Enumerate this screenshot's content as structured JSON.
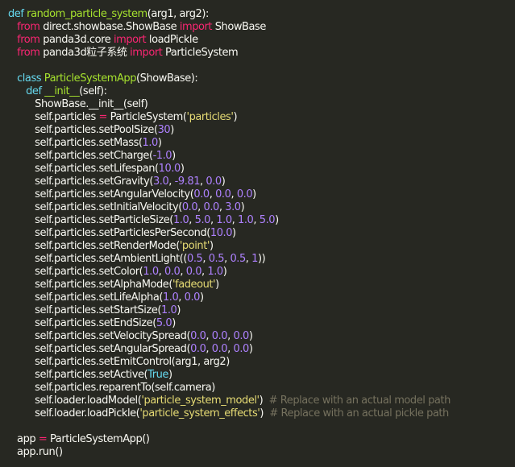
{
  "colors": {
    "background": "#272822",
    "keyword": "#f92672",
    "definition": "#66d9ef",
    "function_name": "#a6e22e",
    "number": "#ae81ff",
    "string": "#e6db74",
    "comment": "#75715e",
    "text": "#f8f8f2"
  },
  "code_lines": [
    [
      {
        "t": "def",
        "c": "def"
      },
      {
        "t": " ",
        "c": "plain"
      },
      {
        "t": "random_particle_system",
        "c": "fn"
      },
      {
        "t": "(arg1, arg2):",
        "c": "plain"
      }
    ],
    [
      {
        "t": "   ",
        "c": "plain"
      },
      {
        "t": "from",
        "c": "kw"
      },
      {
        "t": " direct.showbase.ShowBase ",
        "c": "plain"
      },
      {
        "t": "import",
        "c": "kw"
      },
      {
        "t": " ShowBase",
        "c": "plain"
      }
    ],
    [
      {
        "t": "   ",
        "c": "plain"
      },
      {
        "t": "from",
        "c": "kw"
      },
      {
        "t": " panda3d.core ",
        "c": "plain"
      },
      {
        "t": "import",
        "c": "kw"
      },
      {
        "t": " loadPickle",
        "c": "plain"
      }
    ],
    [
      {
        "t": "   ",
        "c": "plain"
      },
      {
        "t": "from",
        "c": "kw"
      },
      {
        "t": " panda3d粒子系统 ",
        "c": "plain"
      },
      {
        "t": "import",
        "c": "kw"
      },
      {
        "t": " ParticleSystem",
        "c": "plain"
      }
    ],
    [],
    [
      {
        "t": "   ",
        "c": "plain"
      },
      {
        "t": "class",
        "c": "def"
      },
      {
        "t": " ",
        "c": "plain"
      },
      {
        "t": "ParticleSystemApp",
        "c": "fn"
      },
      {
        "t": "(ShowBase):",
        "c": "plain"
      }
    ],
    [
      {
        "t": "      ",
        "c": "plain"
      },
      {
        "t": "def",
        "c": "def"
      },
      {
        "t": " ",
        "c": "plain"
      },
      {
        "t": "__init__",
        "c": "fn"
      },
      {
        "t": "(self):",
        "c": "plain"
      }
    ],
    [
      {
        "t": "         ShowBase.__init__(self)",
        "c": "plain"
      }
    ],
    [
      {
        "t": "         self.particles ",
        "c": "plain"
      },
      {
        "t": "=",
        "c": "op"
      },
      {
        "t": " ParticleSystem(",
        "c": "plain"
      },
      {
        "t": "'particles'",
        "c": "str"
      },
      {
        "t": ")",
        "c": "plain"
      }
    ],
    [
      {
        "t": "         self.particles.setPoolSize(",
        "c": "plain"
      },
      {
        "t": "30",
        "c": "num"
      },
      {
        "t": ")",
        "c": "plain"
      }
    ],
    [
      {
        "t": "         self.particles.setMass(",
        "c": "plain"
      },
      {
        "t": "1.0",
        "c": "num"
      },
      {
        "t": ")",
        "c": "plain"
      }
    ],
    [
      {
        "t": "         self.particles.setCharge(",
        "c": "plain"
      },
      {
        "t": "-1.0",
        "c": "num"
      },
      {
        "t": ")",
        "c": "plain"
      }
    ],
    [
      {
        "t": "         self.particles.setLifespan(",
        "c": "plain"
      },
      {
        "t": "10.0",
        "c": "num"
      },
      {
        "t": ")",
        "c": "plain"
      }
    ],
    [
      {
        "t": "         self.particles.setGravity(",
        "c": "plain"
      },
      {
        "t": "3.0",
        "c": "num"
      },
      {
        "t": ", ",
        "c": "plain"
      },
      {
        "t": "-9.81",
        "c": "num"
      },
      {
        "t": ", ",
        "c": "plain"
      },
      {
        "t": "0.0",
        "c": "num"
      },
      {
        "t": ")",
        "c": "plain"
      }
    ],
    [
      {
        "t": "         self.particles.setAngularVelocity(",
        "c": "plain"
      },
      {
        "t": "0.0",
        "c": "num"
      },
      {
        "t": ", ",
        "c": "plain"
      },
      {
        "t": "0.0",
        "c": "num"
      },
      {
        "t": ", ",
        "c": "plain"
      },
      {
        "t": "0.0",
        "c": "num"
      },
      {
        "t": ")",
        "c": "plain"
      }
    ],
    [
      {
        "t": "         self.particles.setInitialVelocity(",
        "c": "plain"
      },
      {
        "t": "0.0",
        "c": "num"
      },
      {
        "t": ", ",
        "c": "plain"
      },
      {
        "t": "0.0",
        "c": "num"
      },
      {
        "t": ", ",
        "c": "plain"
      },
      {
        "t": "3.0",
        "c": "num"
      },
      {
        "t": ")",
        "c": "plain"
      }
    ],
    [
      {
        "t": "         self.particles.setParticleSize(",
        "c": "plain"
      },
      {
        "t": "1.0",
        "c": "num"
      },
      {
        "t": ", ",
        "c": "plain"
      },
      {
        "t": "5.0",
        "c": "num"
      },
      {
        "t": ", ",
        "c": "plain"
      },
      {
        "t": "1.0",
        "c": "num"
      },
      {
        "t": ", ",
        "c": "plain"
      },
      {
        "t": "1.0",
        "c": "num"
      },
      {
        "t": ", ",
        "c": "plain"
      },
      {
        "t": "5.0",
        "c": "num"
      },
      {
        "t": ")",
        "c": "plain"
      }
    ],
    [
      {
        "t": "         self.particles.setParticlesPerSecond(",
        "c": "plain"
      },
      {
        "t": "10.0",
        "c": "num"
      },
      {
        "t": ")",
        "c": "plain"
      }
    ],
    [
      {
        "t": "         self.particles.setRenderMode(",
        "c": "plain"
      },
      {
        "t": "'point'",
        "c": "str"
      },
      {
        "t": ")",
        "c": "plain"
      }
    ],
    [
      {
        "t": "         self.particles.setAmbientLight((",
        "c": "plain"
      },
      {
        "t": "0.5",
        "c": "num"
      },
      {
        "t": ", ",
        "c": "plain"
      },
      {
        "t": "0.5",
        "c": "num"
      },
      {
        "t": ", ",
        "c": "plain"
      },
      {
        "t": "0.5",
        "c": "num"
      },
      {
        "t": ", ",
        "c": "plain"
      },
      {
        "t": "1",
        "c": "num"
      },
      {
        "t": "))",
        "c": "plain"
      }
    ],
    [
      {
        "t": "         self.particles.setColor(",
        "c": "plain"
      },
      {
        "t": "1.0",
        "c": "num"
      },
      {
        "t": ", ",
        "c": "plain"
      },
      {
        "t": "0.0",
        "c": "num"
      },
      {
        "t": ", ",
        "c": "plain"
      },
      {
        "t": "0.0",
        "c": "num"
      },
      {
        "t": ", ",
        "c": "plain"
      },
      {
        "t": "1.0",
        "c": "num"
      },
      {
        "t": ")",
        "c": "plain"
      }
    ],
    [
      {
        "t": "         self.particles.setAlphaMode(",
        "c": "plain"
      },
      {
        "t": "'fadeout'",
        "c": "str"
      },
      {
        "t": ")",
        "c": "plain"
      }
    ],
    [
      {
        "t": "         self.particles.setLifeAlpha(",
        "c": "plain"
      },
      {
        "t": "1.0",
        "c": "num"
      },
      {
        "t": ", ",
        "c": "plain"
      },
      {
        "t": "0.0",
        "c": "num"
      },
      {
        "t": ")",
        "c": "plain"
      }
    ],
    [
      {
        "t": "         self.particles.setStartSize(",
        "c": "plain"
      },
      {
        "t": "1.0",
        "c": "num"
      },
      {
        "t": ")",
        "c": "plain"
      }
    ],
    [
      {
        "t": "         self.particles.setEndSize(",
        "c": "plain"
      },
      {
        "t": "5.0",
        "c": "num"
      },
      {
        "t": ")",
        "c": "plain"
      }
    ],
    [
      {
        "t": "         self.particles.setVelocitySpread(",
        "c": "plain"
      },
      {
        "t": "0.0",
        "c": "num"
      },
      {
        "t": ", ",
        "c": "plain"
      },
      {
        "t": "0.0",
        "c": "num"
      },
      {
        "t": ", ",
        "c": "plain"
      },
      {
        "t": "0.0",
        "c": "num"
      },
      {
        "t": ")",
        "c": "plain"
      }
    ],
    [
      {
        "t": "         self.particles.setAngularSpread(",
        "c": "plain"
      },
      {
        "t": "0.0",
        "c": "num"
      },
      {
        "t": ", ",
        "c": "plain"
      },
      {
        "t": "0.0",
        "c": "num"
      },
      {
        "t": ", ",
        "c": "plain"
      },
      {
        "t": "0.0",
        "c": "num"
      },
      {
        "t": ")",
        "c": "plain"
      }
    ],
    [
      {
        "t": "         self.particles.setEmitControl(arg1, arg2)",
        "c": "plain"
      }
    ],
    [
      {
        "t": "         self.particles.setActive(",
        "c": "plain"
      },
      {
        "t": "True",
        "c": "def"
      },
      {
        "t": ")",
        "c": "plain"
      }
    ],
    [
      {
        "t": "         self.particles.reparentTo(self.camera)",
        "c": "plain"
      }
    ],
    [
      {
        "t": "         self.loader.loadModel(",
        "c": "plain"
      },
      {
        "t": "'particle_system_model'",
        "c": "str"
      },
      {
        "t": ")  ",
        "c": "plain"
      },
      {
        "t": "# Replace with an actual model path",
        "c": "cmt"
      }
    ],
    [
      {
        "t": "         self.loader.loadPickle(",
        "c": "plain"
      },
      {
        "t": "'particle_system_effects'",
        "c": "str"
      },
      {
        "t": ")  ",
        "c": "plain"
      },
      {
        "t": "# Replace with an actual pickle path",
        "c": "cmt"
      }
    ],
    [],
    [
      {
        "t": "   app ",
        "c": "plain"
      },
      {
        "t": "=",
        "c": "op"
      },
      {
        "t": " ParticleSystemApp()",
        "c": "plain"
      }
    ],
    [
      {
        "t": "   app.run()",
        "c": "plain"
      }
    ]
  ]
}
